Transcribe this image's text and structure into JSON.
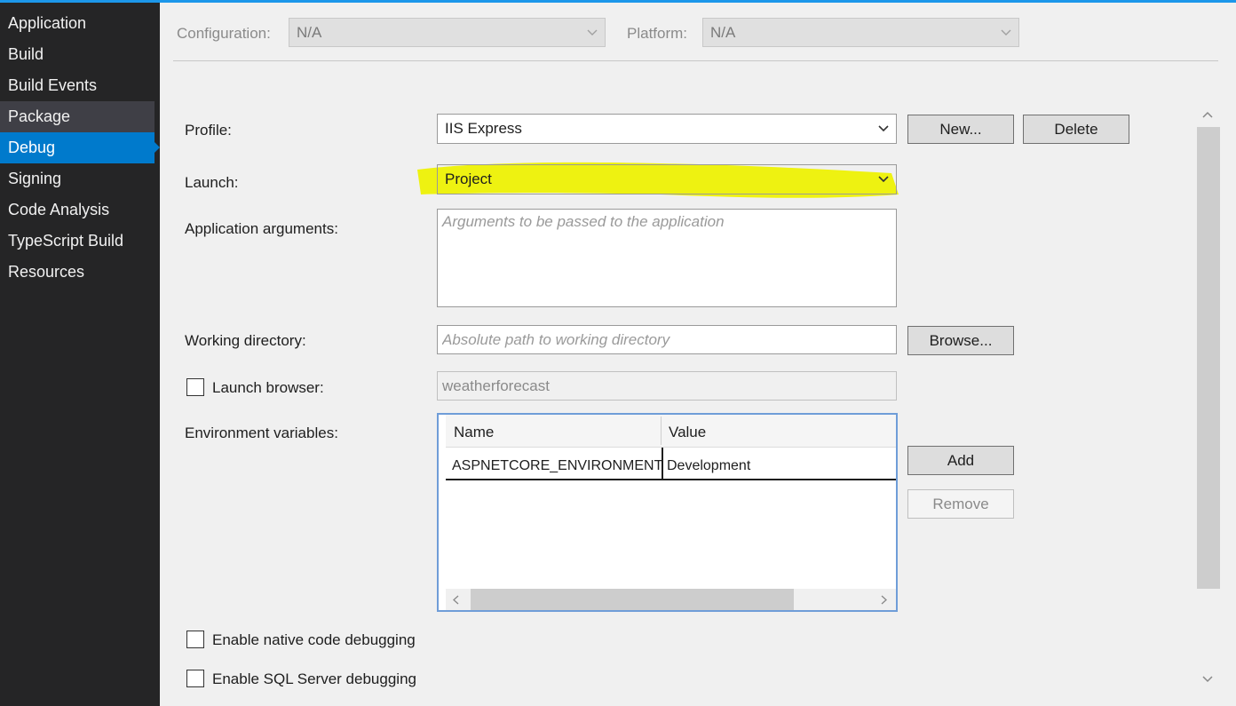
{
  "sidebar": {
    "items": [
      {
        "label": "Application"
      },
      {
        "label": "Build"
      },
      {
        "label": "Build Events"
      },
      {
        "label": "Package"
      },
      {
        "label": "Debug"
      },
      {
        "label": "Signing"
      },
      {
        "label": "Code Analysis"
      },
      {
        "label": "TypeScript Build"
      },
      {
        "label": "Resources"
      }
    ],
    "active": "Debug"
  },
  "header": {
    "configuration_label": "Configuration:",
    "configuration_value": "N/A",
    "platform_label": "Platform:",
    "platform_value": "N/A"
  },
  "profile": {
    "label": "Profile:",
    "value": "IIS Express",
    "new_button": "New...",
    "delete_button": "Delete"
  },
  "launch": {
    "label": "Launch:",
    "value": "Project"
  },
  "app_args": {
    "label": "Application arguments:",
    "placeholder": "Arguments to be passed to the application"
  },
  "working_dir": {
    "label": "Working directory:",
    "placeholder": "Absolute path to working directory",
    "browse_button": "Browse..."
  },
  "launch_browser": {
    "label": "Launch browser:",
    "value": "weatherforecast"
  },
  "env_vars": {
    "label": "Environment variables:",
    "columns": [
      "Name",
      "Value"
    ],
    "rows": [
      {
        "name": "ASPNETCORE_ENVIRONMENT",
        "value": "Development"
      }
    ],
    "add_button": "Add",
    "remove_button": "Remove"
  },
  "native_debug": {
    "label": "Enable native code debugging"
  },
  "sql_debug": {
    "label": "Enable SQL Server debugging"
  },
  "colors": {
    "sidebar_bg": "#252526",
    "active_item": "#007acc",
    "highlighter": "#eef200"
  }
}
